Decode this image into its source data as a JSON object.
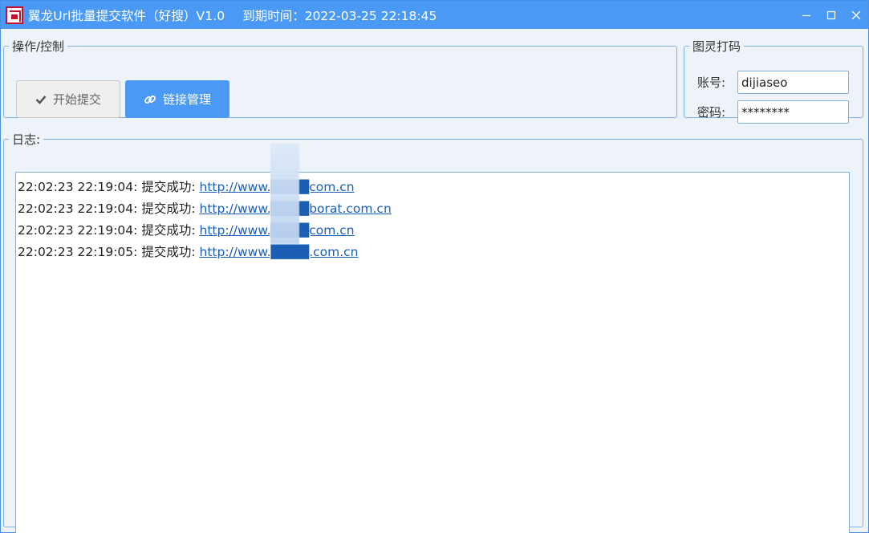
{
  "window": {
    "title": "翼龙Url批量提交软件（好搜）V1.0",
    "expire_label": "到期时间：",
    "expire_value": "2022-03-25 22:18:45"
  },
  "operations": {
    "legend": "操作/控制",
    "start_button_label": "开始提交",
    "links_button_label": "链接管理"
  },
  "captcha": {
    "legend": "图灵打码",
    "account_label": "账号:",
    "account_value": "dijiaseo",
    "password_label": "密码:",
    "password_value": "********"
  },
  "log": {
    "legend": "日志:",
    "entries": [
      {
        "time": "22:02:23 22:19:04:",
        "status": "提交成功:",
        "url": "http://www.████com.cn"
      },
      {
        "time": "22:02:23 22:19:04:",
        "status": "提交成功:",
        "url": "http://www.████borat.com.cn"
      },
      {
        "time": "22:02:23 22:19:04:",
        "status": "提交成功:",
        "url": "http://www.████com.cn"
      },
      {
        "time": "22:02:23 22:19:05:",
        "status": "提交成功:",
        "url": "http://www.████.com.cn"
      }
    ]
  },
  "colors": {
    "titlebar": "#4a9af5",
    "primary_button": "#4a9af5",
    "border": "#7fb0e0",
    "link": "#1a5fb4"
  },
  "icons": [
    "app-logo-icon",
    "minimize-icon",
    "maximize-icon",
    "close-icon",
    "check-icon",
    "link-icon"
  ]
}
